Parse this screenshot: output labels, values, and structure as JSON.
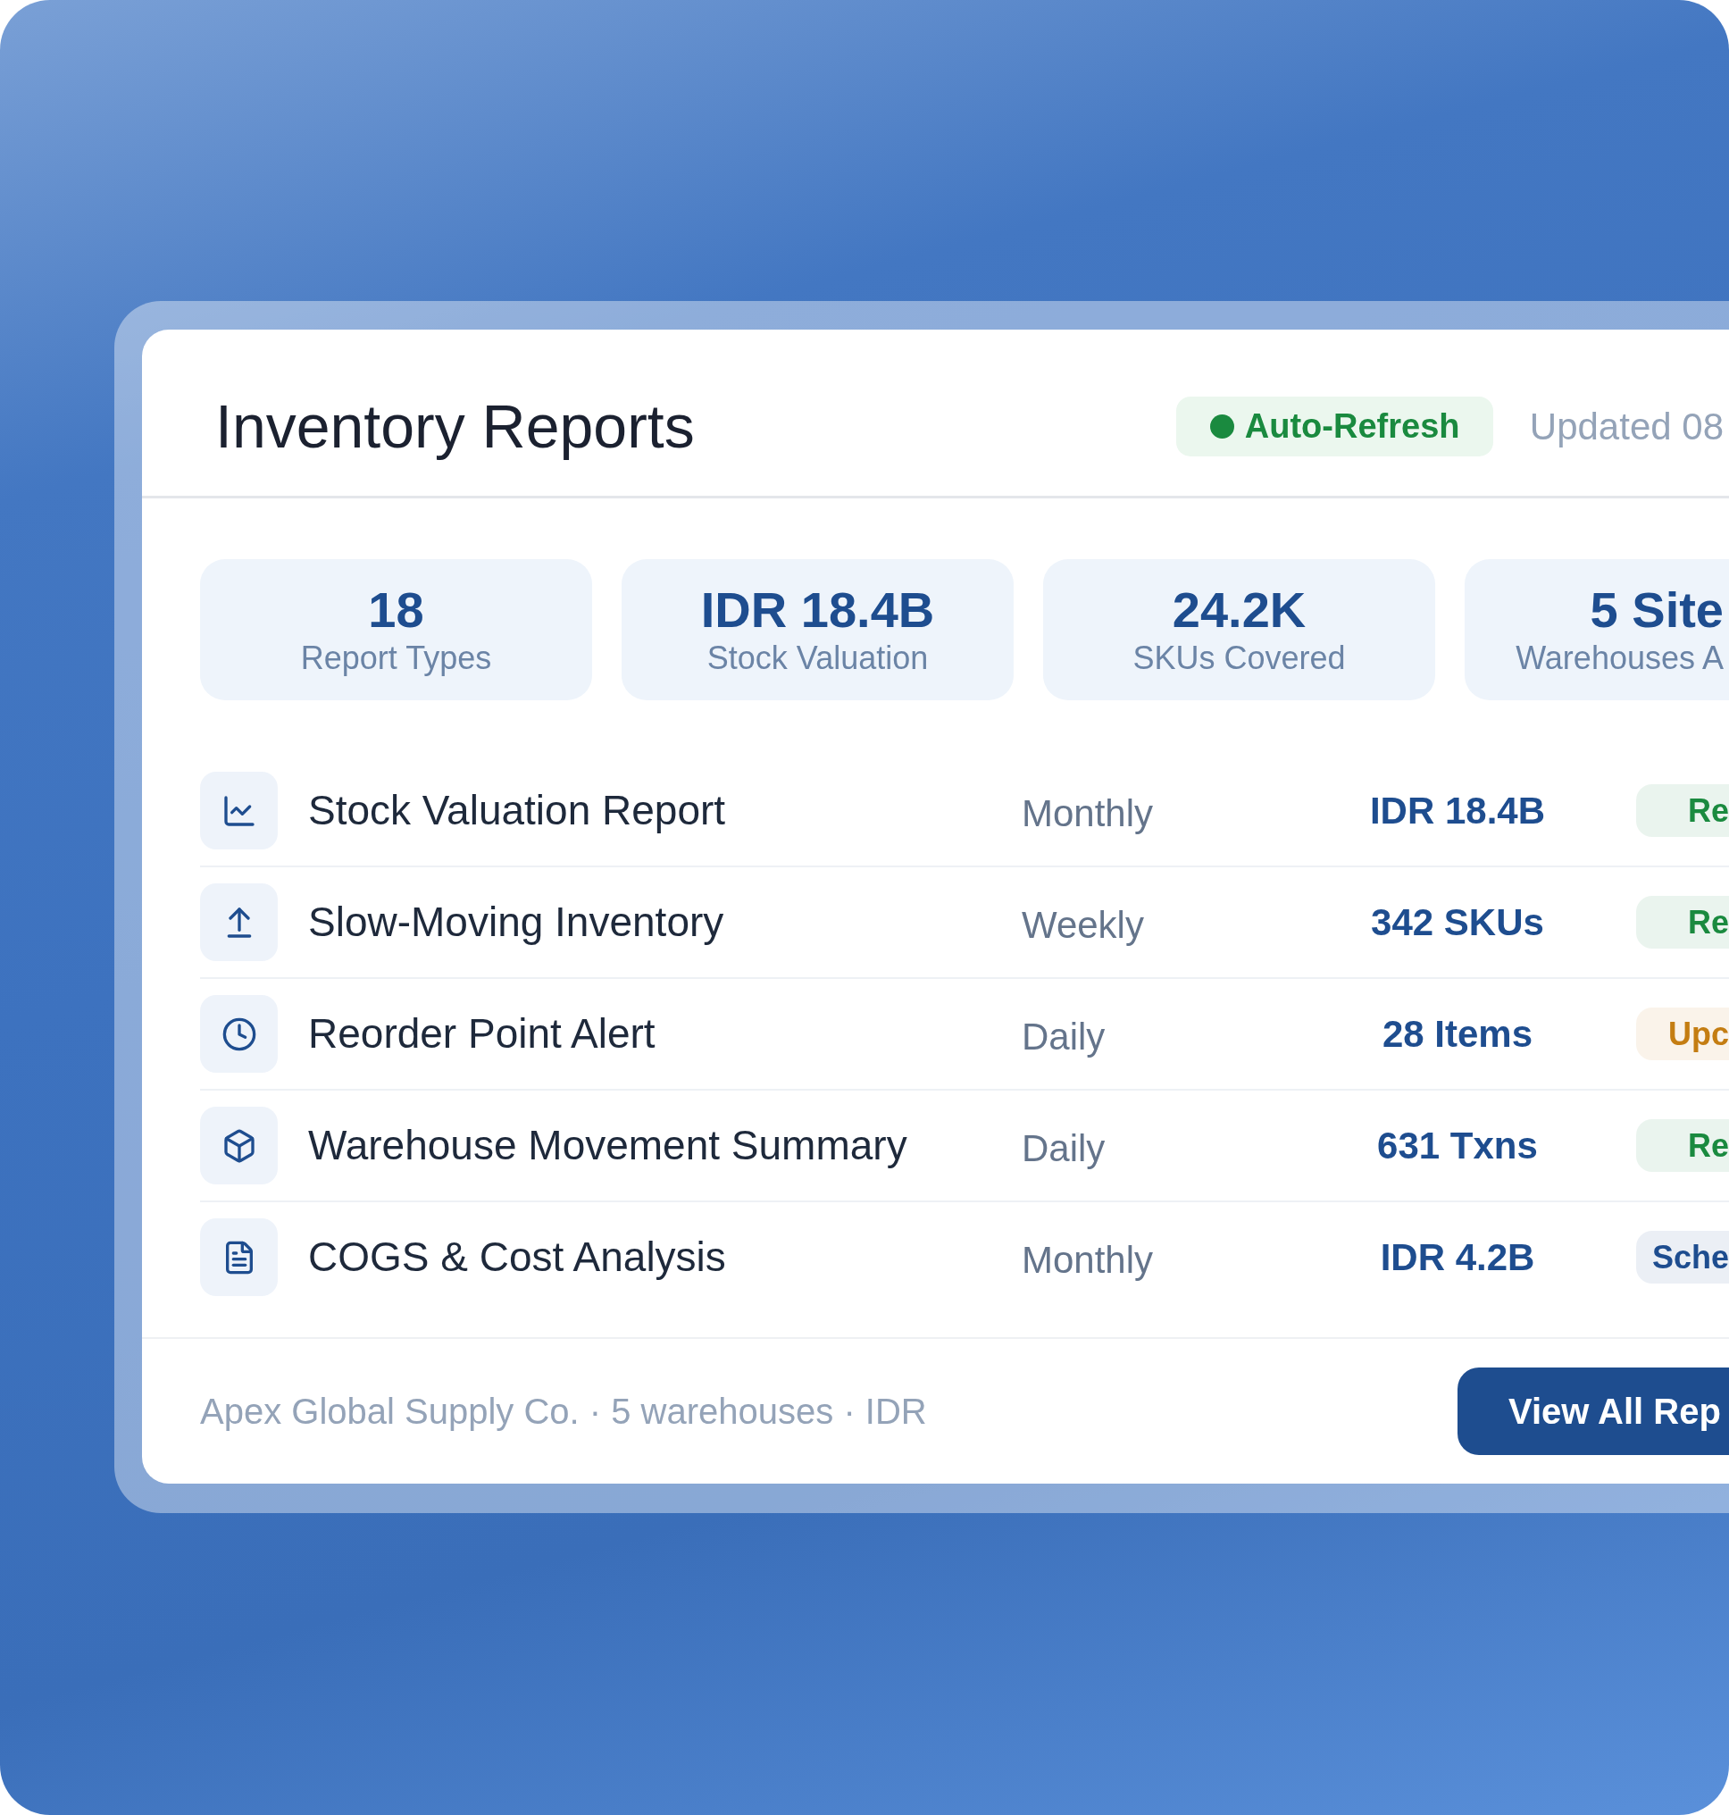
{
  "header": {
    "title": "Inventory Reports",
    "auto_refresh": "Auto-Refresh",
    "updated": "Updated 08"
  },
  "stats": [
    {
      "value": "18",
      "label": "Report Types"
    },
    {
      "value": "IDR 18.4B",
      "label": "Stock Valuation"
    },
    {
      "value": "24.2K",
      "label": "SKUs Covered"
    },
    {
      "value": "5 Site",
      "label": "Warehouses A"
    }
  ],
  "reports": [
    {
      "name": "Stock Valuation Report",
      "frequency": "Monthly",
      "value": "IDR 18.4B",
      "status": {
        "label": "Re",
        "color": "#1a8a3f"
      }
    },
    {
      "name": "Slow-Moving Inventory",
      "frequency": "Weekly",
      "value": "342 SKUs",
      "status": {
        "label": "Re",
        "color": "#1a8a3f"
      }
    },
    {
      "name": "Reorder Point Alert",
      "frequency": "Daily",
      "value": "28 Items",
      "status": {
        "label": "Upc",
        "color": "#c47d12"
      }
    },
    {
      "name": "Warehouse Movement Summary",
      "frequency": "Daily",
      "value": "631 Txns",
      "status": {
        "label": "Re",
        "color": "#1a8a3f"
      }
    },
    {
      "name": "COGS & Cost Analysis",
      "frequency": "Monthly",
      "value": "IDR 4.2B",
      "status": {
        "label": "Sche",
        "color": "#1e4d8f"
      }
    }
  ],
  "footer": {
    "text": "Apex Global Supply Co. · 5 warehouses · IDR",
    "button": "View All Rep"
  }
}
